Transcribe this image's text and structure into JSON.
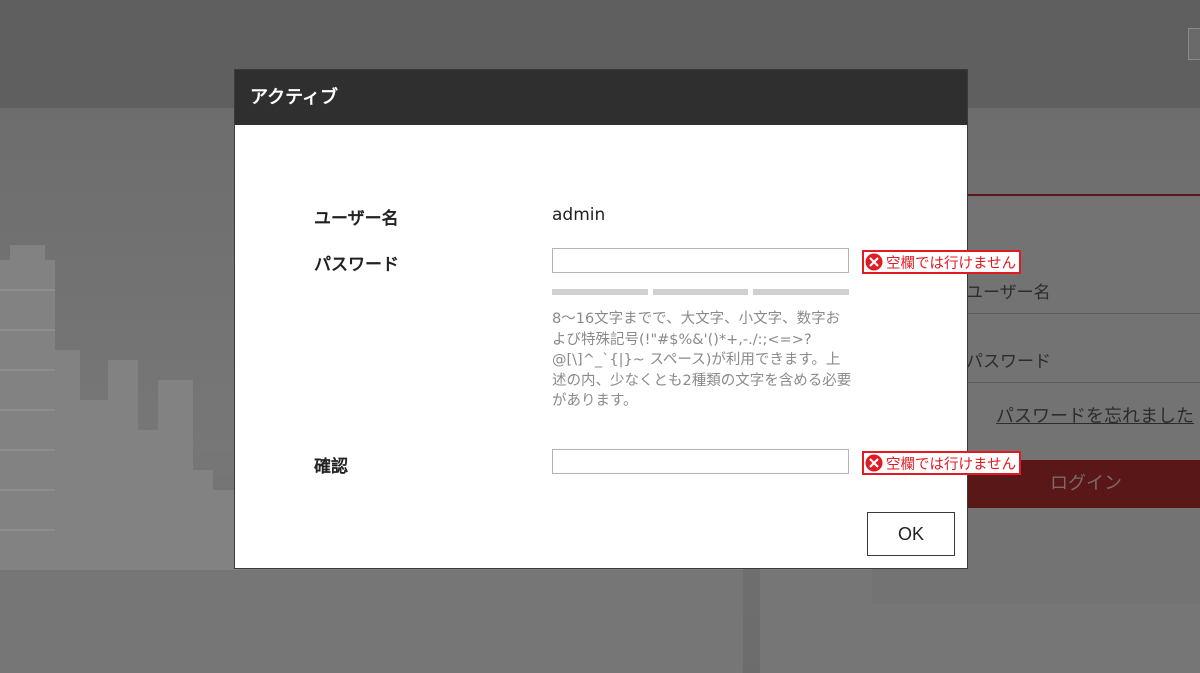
{
  "background": {
    "login_form": {
      "username_placeholder": "ユーザー名",
      "password_placeholder": "パスワード",
      "forgot_password_link": "パスワードを忘れました",
      "login_button": "ログイン"
    }
  },
  "dialog": {
    "title": "アクティブ",
    "username_label": "ユーザー名",
    "username_value": "admin",
    "password_label": "パスワード",
    "password_value": "",
    "password_hint": "8～16文字までで、大文字、小文字、数字および特殊記号(!\"#$%&'()*+,-./:;<=>?@[\\]^_`{|}~ スペース)が利用できます。上述の内、少なくとも2種類の文字を含める必要があります。",
    "confirm_label": "確認",
    "confirm_value": "",
    "password_error": "空欄では行けません",
    "confirm_error": "空欄では行けません",
    "ok_button": "OK"
  },
  "colors": {
    "error": "#e21b23",
    "header_bg": "#2f2f2f",
    "login_button_bg": "#5a1717"
  },
  "icons": {
    "error_icon": "circle-x-icon"
  }
}
